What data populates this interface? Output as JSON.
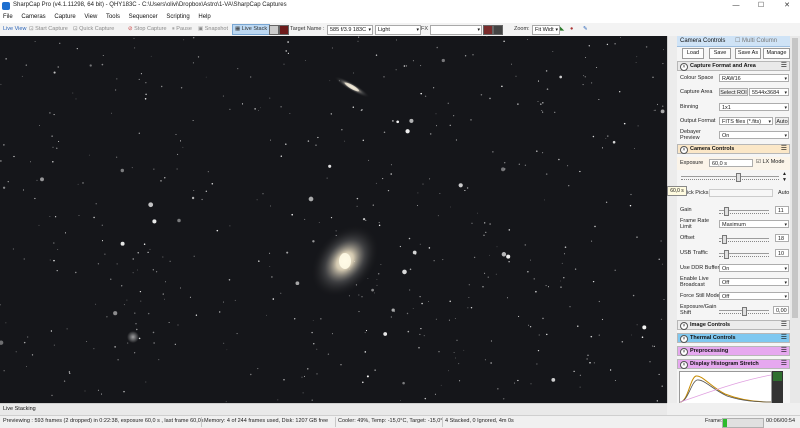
{
  "window": {
    "title": "SharpCap Pro (v4.1.11298, 64 bit) - QHY183C - C:\\Users\\olivi\\Dropbox\\Astro\\1-VA\\SharpCap Captures",
    "minimize": "—",
    "maximize": "☐",
    "close": "✕"
  },
  "menu": [
    "File",
    "Cameras",
    "Capture",
    "View",
    "Tools",
    "Sequencer",
    "Scripting",
    "Help"
  ],
  "toolbar": {
    "live_view": "Live View",
    "start_capture": "Start Capture",
    "quick_capture": "Quick Capture",
    "stop_capture": "Stop Capture",
    "pause": "Pause",
    "snapshot": "Snapshot",
    "live_stack": "Live Stack",
    "target_name_label": "Target Name :",
    "target_name_value": "585 f/3.9 183C",
    "preset_value": "Light",
    "fx_label": "FX",
    "zoom_label": "Zoom:",
    "zoom_value": "Fit Widt"
  },
  "panel": {
    "header": "Camera Controls",
    "multi_column": "Multi Column",
    "buttons": {
      "load": "Load",
      "save": "Save",
      "save_as": "Save As",
      "manage": "Manage"
    },
    "capture_format": {
      "title": "Capture Format and Area",
      "colour_space_label": "Colour Space",
      "colour_space_value": "RAW16",
      "capture_area_label": "Capture Area",
      "select_roi": "Select ROI",
      "capture_area_value": "5544x3684",
      "binning_label": "Binning",
      "binning_value": "1x1",
      "output_format_label": "Output Format",
      "output_format_value": "FITS files (*.fits)",
      "auto": "Auto",
      "debayer_label": "Debayer Preview",
      "debayer_value": "On"
    },
    "camera_controls": {
      "title": "Camera Controls",
      "exposure_label": "Exposure",
      "exposure_value": "60,0 s",
      "lx_mode": "LX Mode",
      "quick_picks_label": "uick Picks",
      "tooltip": "60,0 s",
      "auto": "Auto",
      "gain_label": "Gain",
      "gain_value": "11",
      "gain_level": 0.1,
      "frame_rate_label": "Frame Rate Limit",
      "frame_rate_value": "Maximum",
      "offset_label": "Offset",
      "offset_value": "18",
      "offset_level": 0.07,
      "usb_label": "USB Traffic",
      "usb_value": "10",
      "usb_level": 0.12,
      "ddr_label": "Use DDR Buffer",
      "ddr_value": "On",
      "live_broadcast_label": "Enable Live Broadcast",
      "live_broadcast_value": "Off",
      "force_still_label": "Force Still Mode",
      "force_still_value": "Off",
      "exp_gain_shift_label": "Exposure/Gain Shift",
      "exp_gain_shift_value": "0,00",
      "exp_gain_shift_level": 0.5
    },
    "sections": {
      "image_controls": "Image Controls",
      "thermal_controls": "Thermal Controls",
      "preprocessing": "Preprocessing",
      "display_histogram": "Display Histogram Stretch"
    },
    "colors": {
      "thermal": "#7fc8f0",
      "preprocessing": "#e6a8ef",
      "histogram": "#e6a8ef",
      "camera": "#fbe7c7"
    }
  },
  "live_stacking_tab": "Live Stacking",
  "status": {
    "previewing": "Previewing : 593 frames (2 dropped) in 0:22:38, exposure 60,0 s , last frame 60,0s",
    "memory": "Memory: 4 of 244 frames used, Disk: 1207 GB free",
    "cooler": "Cooler: 49%, Temp: -15,0°C, Target: -15,0°",
    "stacked": "4 Stacked, 0 Ignored, 4m 0s",
    "frame_label": "Frame:",
    "frame_time": "00:06/00:54",
    "frame_progress": 0.11
  },
  "icons": [
    "app-icon",
    "live-view-icon",
    "start-capture-icon",
    "quick-capture-icon",
    "stop-icon",
    "pause-icon",
    "snapshot-icon",
    "live-stack-icon",
    "chevron-icon",
    "menu-icon"
  ]
}
